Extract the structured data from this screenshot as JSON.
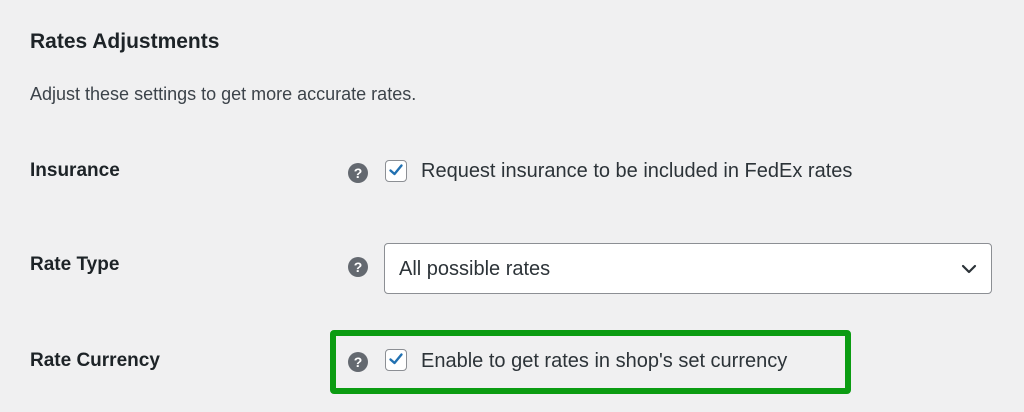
{
  "section": {
    "title": "Rates Adjustments",
    "description": "Adjust these settings to get more accurate rates."
  },
  "rows": {
    "insurance": {
      "label": "Insurance",
      "help_icon": "?",
      "checked": true,
      "checkbox_label": "Request insurance to be included in FedEx rates"
    },
    "rate_type": {
      "label": "Rate Type",
      "help_icon": "?",
      "selected": "All possible rates"
    },
    "rate_currency": {
      "label": "Rate Currency",
      "help_icon": "?",
      "checked": true,
      "checkbox_label": "Enable to get rates in shop's set currency",
      "highlighted": true
    }
  },
  "colors": {
    "background": "#f0f0f1",
    "accent_check": "#2271b1",
    "highlight": "#0b9c12",
    "help_icon_bg": "#646970"
  },
  "icons": {
    "help": "question-circle-icon",
    "check": "checkmark-icon",
    "chevron": "chevron-down-icon"
  }
}
